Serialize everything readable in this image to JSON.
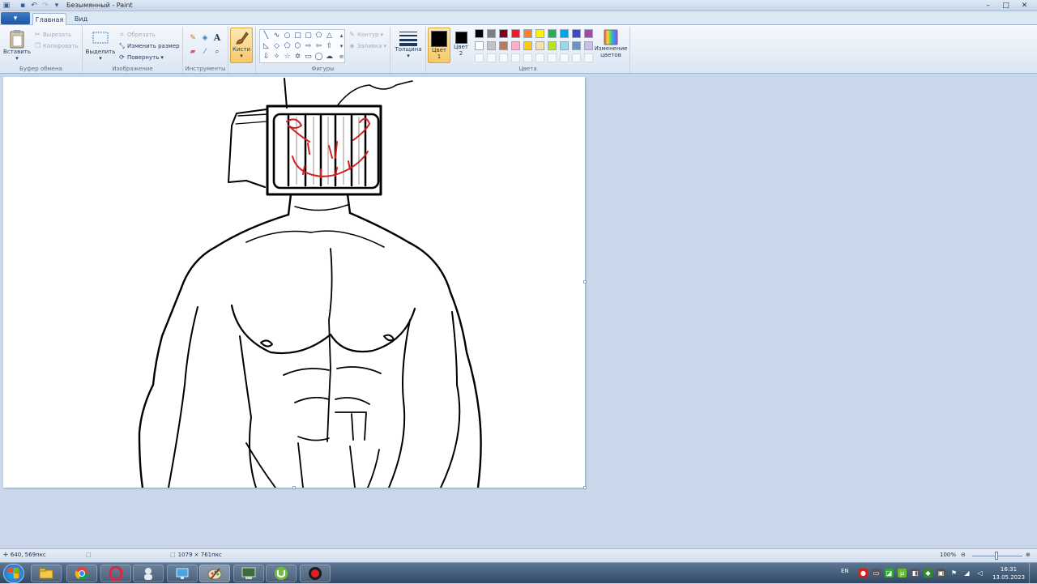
{
  "window": {
    "title": "Безымянный - Paint",
    "minimize_glyph": "–",
    "maximize_glyph": "□",
    "close_glyph": "✕"
  },
  "tabs": {
    "menu_glyph": "▾",
    "home": "Главная",
    "view": "Вид"
  },
  "clipboard": {
    "paste": "Вставить",
    "cut": "Вырезать",
    "copy": "Копировать",
    "label": "Буфер обмена"
  },
  "image": {
    "select": "Выделить",
    "crop": "Обрезать",
    "resize": "Изменить размер",
    "rotate": "Повернуть",
    "label": "Изображение"
  },
  "tools": {
    "label": "Инструменты",
    "text_glyph": "A"
  },
  "brushes": {
    "label": "Кисти"
  },
  "shapes": {
    "outline": "Контур",
    "fill": "Заливка",
    "label": "Фигуры"
  },
  "thickness": {
    "label": "Толщина"
  },
  "colors": {
    "color1_line1": "Цвет",
    "color1_line2": "1",
    "color2_line1": "Цвет",
    "color2_line2": "2",
    "edit_line1": "Изменение",
    "edit_line2": "цветов",
    "label": "Цвета",
    "color1_value": "#000000",
    "color2_value": "#000000",
    "palette": [
      "#000000",
      "#7f7f7f",
      "#880015",
      "#ed1c24",
      "#ff7f27",
      "#fff200",
      "#22b14c",
      "#00a2e8",
      "#3f48cc",
      "#a349a4",
      "#ffffff",
      "#c3c3c3",
      "#b97a57",
      "#ffaec9",
      "#ffc90e",
      "#efe4b0",
      "#b5e61d",
      "#99d9ea",
      "#7092be",
      "#c8bfe7"
    ]
  },
  "status": {
    "cursor_pos": "640, 569пкс",
    "canvas_size": "1079 × 761пкс",
    "zoom": "100%"
  },
  "tray": {
    "lang": "EN",
    "time": "16:31",
    "date": "13.05.2023"
  }
}
